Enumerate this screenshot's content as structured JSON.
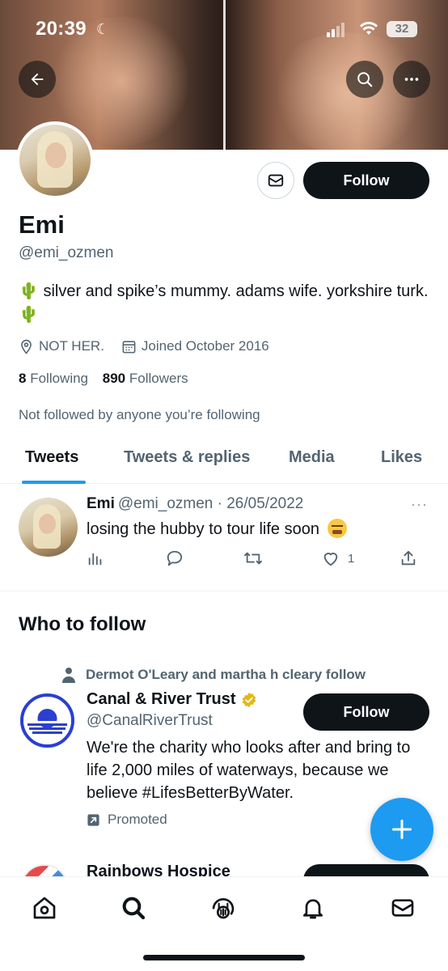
{
  "status_bar": {
    "time": "20:39",
    "battery": "32"
  },
  "profile": {
    "name": "Emi",
    "handle": "@emi_ozmen",
    "bio": "🌵 silver and spike’s mummy. adams wife. yorkshire turk. 🌵",
    "location": "NOT HER.",
    "joined": "Joined October 2016",
    "following_count": "8",
    "following_label": "Following",
    "followers_count": "890",
    "followers_label": "Followers",
    "not_followed_note": "Not followed by anyone you’re following",
    "follow_button": "Follow"
  },
  "tabs": [
    {
      "label": "Tweets",
      "active": true
    },
    {
      "label": "Tweets & replies",
      "active": false
    },
    {
      "label": "Media",
      "active": false
    },
    {
      "label": "Likes",
      "active": false
    }
  ],
  "tweet": {
    "name": "Emi",
    "handle_date": "@emi_ozmen · 26/05/2022",
    "text": "losing the hubby to tour life soon",
    "likes": "1",
    "more": "···"
  },
  "who_to_follow": {
    "title": "Who to follow",
    "social_context": "Dermot O'Leary and martha h cleary follow",
    "account": {
      "name": "Canal & River Trust",
      "handle": "@CanalRiverTrust",
      "bio": "We're the charity who looks after and bring to life 2,000 miles of waterways, because we believe #LifesBetterByWater.",
      "promoted_label": "Promoted",
      "follow_button": "Follow",
      "verified_color": "#e2b719"
    },
    "next_account": {
      "name": "Rainbows Hospice"
    }
  },
  "colors": {
    "accent": "#1d9bf0",
    "text_primary": "#0f1419",
    "text_secondary": "#536471",
    "button_dark": "#0f1419",
    "logo_blue": "#2b3fd1"
  }
}
